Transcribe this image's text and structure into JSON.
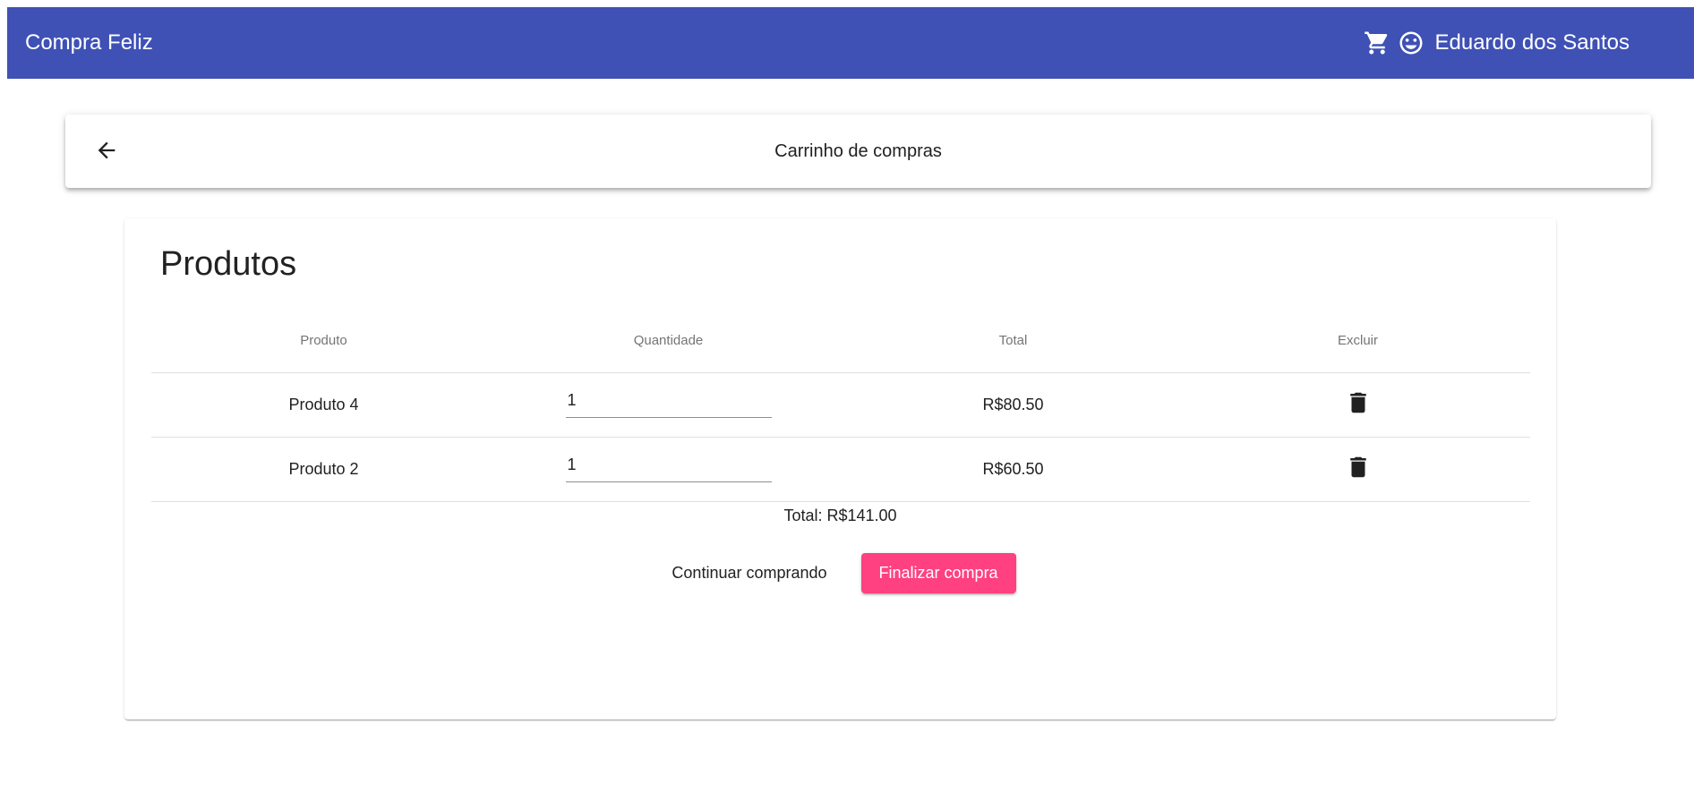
{
  "app": {
    "title": "Compra Feliz",
    "user_name": "Eduardo dos Santos",
    "icons": {
      "cart": "cart-icon",
      "user": "smiley-face-icon"
    },
    "colors": {
      "primary": "#3f51b5",
      "accent": "#ff4081"
    }
  },
  "toolbar": {
    "back_icon": "arrow-left-icon",
    "title": "Carrinho de compras"
  },
  "cart": {
    "heading": "Produtos",
    "columns": [
      "Produto",
      "Quantidade",
      "Total",
      "Excluir"
    ],
    "rows": [
      {
        "product": "Produto 4",
        "quantity": "1",
        "total": "R$80.50",
        "delete_icon": "trash-icon"
      },
      {
        "product": "Produto 2",
        "quantity": "1",
        "total": "R$60.50",
        "delete_icon": "trash-icon"
      }
    ],
    "grand_total": "Total: R$141.00",
    "continue_label": "Continuar comprando",
    "finish_label": "Finalizar compra"
  }
}
